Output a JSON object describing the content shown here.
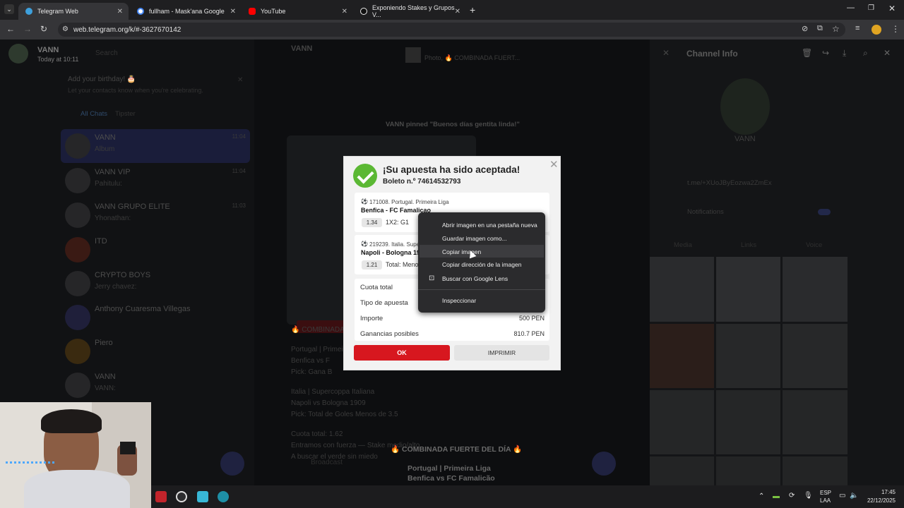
{
  "browser": {
    "tabs": [
      {
        "label": "Telegram Web",
        "color": "#3ea0dc"
      },
      {
        "label": "fullham - Mask'ana Google",
        "color": "#4285f4"
      },
      {
        "label": "YouTube",
        "color": "#ff0000"
      },
      {
        "label": "Exponiendo Stakes y Grupos V...",
        "color": "#111111"
      }
    ],
    "url": "web.telegram.org/k/#-3627670142"
  },
  "left": {
    "user_name": "VANN",
    "user_status": "Today at 10:11",
    "search_placeholder": "Search",
    "birthday_title": "Add your birthday! 🎂",
    "birthday_sub": "Let your contacts know when you're celebrating.",
    "filters": [
      "All Chats",
      "Tipster"
    ],
    "chats": [
      {
        "name": "VANN",
        "msg": "Album",
        "time": "11:04"
      },
      {
        "name": "VANN VIP",
        "msg": "Pahitulu:",
        "time": "11:04"
      },
      {
        "name": "VANN GRUPO ELITE",
        "msg": "Yhonathan:",
        "time": "11:03"
      },
      {
        "name": "ITD",
        "msg": "",
        "time": ""
      },
      {
        "name": "CRYPTO BOYS",
        "msg": "Jerry chavez:",
        "time": ""
      },
      {
        "name": "Anthony Cuaresma Villegas",
        "msg": "",
        "time": ""
      },
      {
        "name": "Piero",
        "msg": "",
        "time": ""
      },
      {
        "name": "VANN",
        "msg": "VANN:",
        "time": ""
      }
    ]
  },
  "mid": {
    "header_name": "VANN",
    "pinned_label": "Photo, 🔥 COMBINADA FUERT...",
    "pinned_msg": "VANN pinned \"Buenos días gentita linda!\"",
    "posts": [
      "🔥 COMBINADA",
      "Portugal | Primeira",
      "Benfica vs F",
      "Pick: Gana B",
      "Italia | Supercoppa Italiana",
      "Napoli vs Bologna 1909",
      "Pick: Total de Goles Menos de 3.5",
      "Cuota total: 1.62",
      "Entramos con fuerza — Stake medio/alto",
      "A buscar el verde sin miedo",
      "🔥 COMBINADA FUERTE DEL DÍA 🔥",
      "Portugal | Primeira Liga",
      "Benfica vs FC Famalicão"
    ],
    "composer_placeholder": "Broadcast"
  },
  "right": {
    "title": "Channel Info",
    "channel_name": "VANN",
    "link": "t.me/+XUoJByEozwa2ZmEx",
    "notifications": "Notifications",
    "tabs": [
      "Media",
      "Links",
      "Voice"
    ]
  },
  "dialog": {
    "title": "¡Su apuesta ha sido aceptada!",
    "ticket": "Boleto n.º 74614532793",
    "events": [
      {
        "meta": "171008. Portugal. Primeira Liga",
        "match": "Benfica - FC Famalicao",
        "odd": "1.34",
        "market": "1X2: G1"
      },
      {
        "meta": "219239. Italia. Supe",
        "match": "Napoli - Bologna 19",
        "odd": "1.21",
        "market": "Total: Meno"
      }
    ],
    "rows": [
      {
        "label": "Cuota total",
        "value": ""
      },
      {
        "label": "Tipo de apuesta",
        "value": ""
      },
      {
        "label": "Importe",
        "value": "500 PEN"
      },
      {
        "label": "Ganancias posibles",
        "value": "810.7 PEN"
      }
    ],
    "ok_label": "OK",
    "print_label": "IMPRIMIR"
  },
  "context_menu": {
    "items": [
      "Abrir imagen en una pestaña nueva",
      "Guardar imagen como...",
      "Copiar imagen",
      "Copiar dirección de la imagen",
      "Buscar con Google Lens",
      "Inspeccionar"
    ]
  },
  "taskbar": {
    "lang": "ESP",
    "lang2": "LAA",
    "time": "17:45",
    "date": "22/12/2025"
  },
  "colors": {
    "accent_red": "#d7171f",
    "success_green": "#5bb834",
    "telegram_blue": "#3ea0dc"
  }
}
